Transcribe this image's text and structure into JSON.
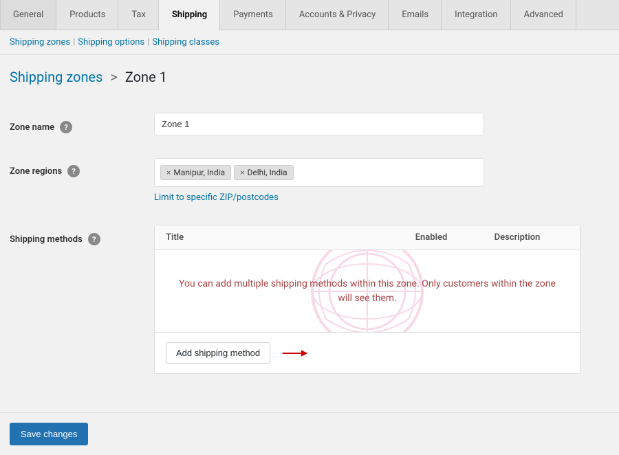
{
  "nav": {
    "tabs": [
      {
        "id": "general",
        "label": "General",
        "active": false
      },
      {
        "id": "products",
        "label": "Products",
        "active": false
      },
      {
        "id": "tax",
        "label": "Tax",
        "active": false
      },
      {
        "id": "shipping",
        "label": "Shipping",
        "active": true
      },
      {
        "id": "payments",
        "label": "Payments",
        "active": false
      },
      {
        "id": "accounts-privacy",
        "label": "Accounts & Privacy",
        "active": false
      },
      {
        "id": "emails",
        "label": "Emails",
        "active": false
      },
      {
        "id": "integration",
        "label": "Integration",
        "active": false
      },
      {
        "id": "advanced",
        "label": "Advanced",
        "active": false
      }
    ]
  },
  "subnav": {
    "links": [
      {
        "id": "shipping-zones",
        "label": "Shipping zones"
      },
      {
        "id": "shipping-options",
        "label": "Shipping options"
      },
      {
        "id": "shipping-classes",
        "label": "Shipping classes"
      }
    ]
  },
  "breadcrumb": {
    "parent_label": "Shipping zones",
    "separator": ">",
    "current": "Zone 1"
  },
  "form": {
    "zone_name_label": "Zone name",
    "zone_name_value": "Zone 1",
    "zone_regions_label": "Zone regions",
    "zone_regions_tags": [
      {
        "label": "Manipur, India"
      },
      {
        "label": "Delhi, India"
      }
    ],
    "limit_link_text": "Limit to specific ZIP/postcodes",
    "shipping_methods_label": "Shipping methods",
    "shipping_methods_table": {
      "col_title": "Title",
      "col_enabled": "Enabled",
      "col_description": "Description",
      "empty_text": "You can add multiple shipping methods within this zone. Only customers within the zone will see them.",
      "add_button_label": "Add shipping method"
    }
  },
  "footer": {
    "save_label": "Save changes"
  },
  "colors": {
    "accent_blue": "#0073aa",
    "active_tab": "#f1f1f1",
    "save_btn": "#2271b1",
    "empty_text": "#c06",
    "arrow_red": "#cc0000"
  }
}
